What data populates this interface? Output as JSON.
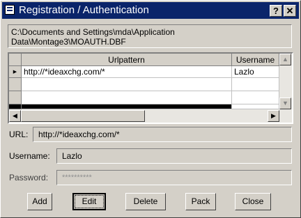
{
  "window": {
    "title": "Registration / Authentication",
    "help_label": "?",
    "close_label": "✕"
  },
  "path_text": "C:\\Documents and Settings\\mda\\Application Data\\Montage3\\MOAUTH.DBF",
  "grid": {
    "columns": [
      "Urlpattern",
      "Username"
    ],
    "rows": [
      {
        "urlpattern": "http://*ideaxchg.com/*",
        "username": "Lazlo",
        "current": true
      },
      {
        "urlpattern": "",
        "username": ""
      },
      {
        "urlpattern": "",
        "username": ""
      }
    ]
  },
  "form": {
    "url_label": "URL:",
    "url_value": "http://*ideaxchg.com/*",
    "username_label": "Username:",
    "username_value": "Lazlo",
    "password_label": "Password:",
    "password_value": "**********"
  },
  "buttons": {
    "add": "Add",
    "edit": "Edit",
    "delete": "Delete",
    "pack": "Pack",
    "close": "Close"
  },
  "icons": {
    "row_pointer": "▶",
    "scroll_up": "▲",
    "scroll_down": "▼",
    "scroll_left": "◀",
    "scroll_right": "▶"
  }
}
